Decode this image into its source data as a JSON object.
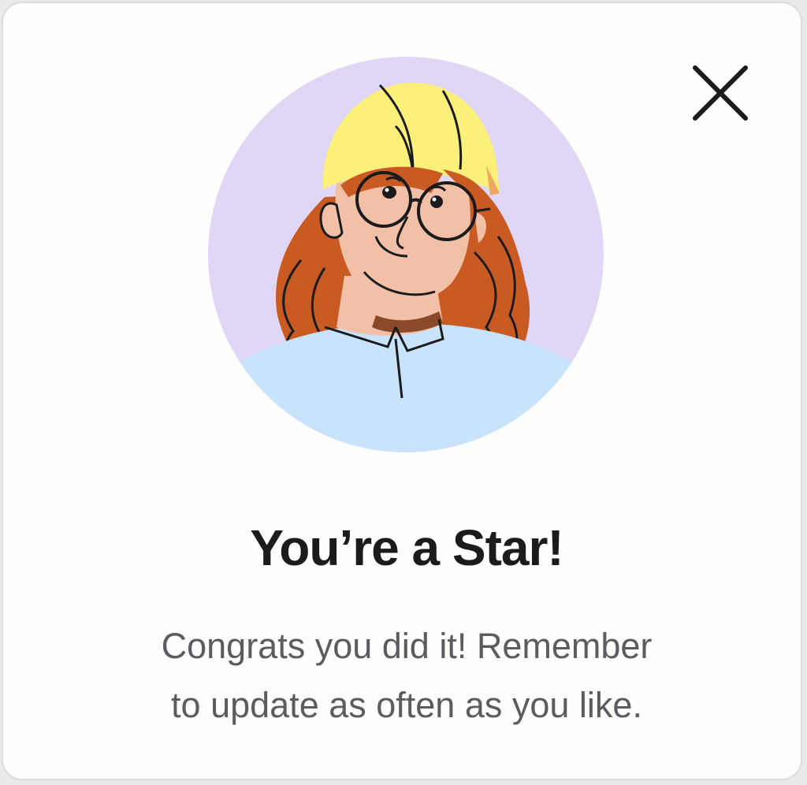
{
  "dialog": {
    "title": "You’re a Star!",
    "message_line1": "Congrats you did it! Remember",
    "message_line2": "to update as often as you like.",
    "close_icon": "close-icon",
    "illustration": "avatar-illustration-worker-hard-hat"
  },
  "colors": {
    "background": "#fefefe",
    "title": "#1b1b1d",
    "message": "#5b5b60",
    "avatar_bg": "#e0d6f6",
    "shirt": "#c8e3fb",
    "hat": "#fbf07a",
    "hair": "#c95a22",
    "skin": "#f1c0a6"
  }
}
